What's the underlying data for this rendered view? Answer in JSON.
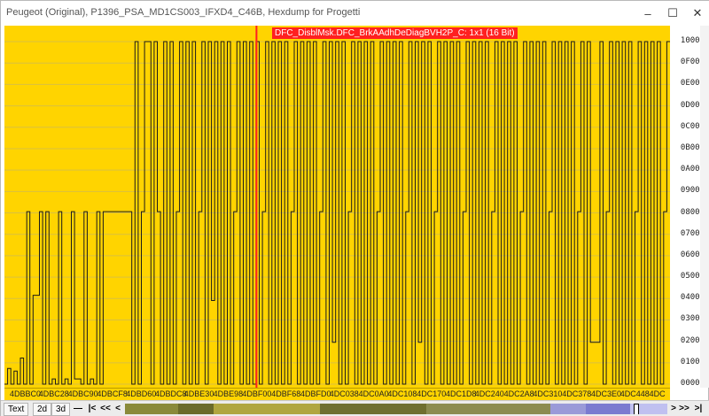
{
  "window": {
    "title": "Peugeot (Original), P1396_PSA_MD1CS003_IFXD4_C46B, Hexdump for Progetti",
    "min_glyph": "–",
    "max_glyph": "☐",
    "close_glyph": "✕"
  },
  "map": {
    "label": "DFC_DisblMsk.DFC_BrkAAdhDeDiagBVH2P_C: 1x1 (16 Bit)"
  },
  "colors": {
    "plot_background": "#ffd400",
    "trace": "#1a1a1a",
    "cursor": "#ff2020",
    "grid": "#d9c040"
  },
  "y_axis": {
    "ticks": [
      "10000",
      "0F000",
      "0E000",
      "0D000",
      "0C000",
      "0B000",
      "0A000",
      "09000",
      "08000",
      "07000",
      "06000",
      "05000",
      "04000",
      "03000",
      "02000",
      "01000",
      "00000"
    ]
  },
  "x_axis": {
    "ticks": [
      "4DBBC0",
      "4DBC28",
      "4DBC90",
      "4DBCF8",
      "4DBD60",
      "4DBDC8",
      "4DBE30",
      "4DBE98",
      "4DBF00",
      "4DBF68",
      "4DBFD0",
      "4DC038",
      "4DC0A0",
      "4DC108",
      "4DC170",
      "4DC1D8",
      "4DC240",
      "4DC2A8",
      "4DC310",
      "4DC378",
      "4DC3E0",
      "4DC448",
      "4DC"
    ]
  },
  "statusbar": {
    "tab_text": "Text",
    "tab_2d": "2d",
    "tab_3d": "3d",
    "nav_minus": "—",
    "nav_first": "|<",
    "nav_fast_back": "<<",
    "nav_back": "<",
    "nav_fwd": ">",
    "nav_fast_fwd": ">>",
    "nav_last": ">|"
  },
  "chart_data": {
    "type": "line",
    "title": "",
    "xlabel": "",
    "ylabel": "",
    "ylim": [
      0,
      65536
    ],
    "x_range": [
      "4DBBC0",
      "4DC4B0"
    ],
    "series": [
      {
        "values": [
          0,
          3000,
          0,
          2500,
          0,
          5000,
          0,
          33000,
          0,
          17000,
          17000,
          33000,
          0,
          33000,
          0,
          1000,
          0,
          33000,
          0,
          1000,
          0,
          33000,
          1000,
          1000,
          0,
          33000,
          0,
          1000,
          0,
          33000,
          0,
          33000,
          33000,
          33000,
          33000,
          33000,
          33000,
          33000,
          33000,
          33000,
          0,
          65535,
          0,
          33000,
          65535,
          65535,
          0,
          65535,
          33000,
          0,
          65535,
          0,
          65535,
          0,
          33000,
          65535,
          0,
          65535,
          0,
          65535,
          0,
          33000,
          65535,
          0,
          65535,
          16000,
          65535,
          0,
          65535,
          0,
          65535,
          0,
          33000,
          65535,
          0,
          65535,
          0,
          65535,
          0,
          65535,
          0,
          33000,
          65535,
          0,
          65535,
          0,
          65535,
          0,
          65535,
          0,
          33000,
          65535,
          0,
          65535,
          0,
          65535,
          0,
          65535,
          0,
          33000,
          65535,
          0,
          65535,
          8000,
          65535,
          0,
          65535,
          0,
          33000,
          65535,
          0,
          65535,
          0,
          65535,
          0,
          65535,
          0,
          33000,
          65535,
          0,
          65535,
          0,
          65535,
          0,
          65535,
          0,
          33000,
          65535,
          0,
          65535,
          8000,
          65535,
          0,
          65535,
          0,
          33000,
          65535,
          0,
          65535,
          0,
          65535,
          0,
          65535,
          0,
          33000,
          65535,
          0,
          65535,
          0,
          65535,
          0,
          65535,
          0,
          33000,
          65535,
          0,
          65535,
          0,
          65535,
          0,
          65535,
          0,
          33000,
          65535,
          0,
          65535,
          0,
          65535,
          0,
          65535,
          0,
          33000,
          65535,
          0,
          65535,
          0,
          65535,
          0,
          65535,
          0,
          33000,
          65535,
          0,
          65535,
          8000,
          8000,
          8000,
          65535,
          0,
          33000,
          65535,
          0,
          65535,
          0,
          65535,
          0,
          65535,
          0,
          33000,
          65535,
          0,
          65535,
          0,
          65535,
          0,
          65535,
          0,
          33000,
          65535
        ]
      }
    ],
    "cursor_x": "4DBF00"
  }
}
